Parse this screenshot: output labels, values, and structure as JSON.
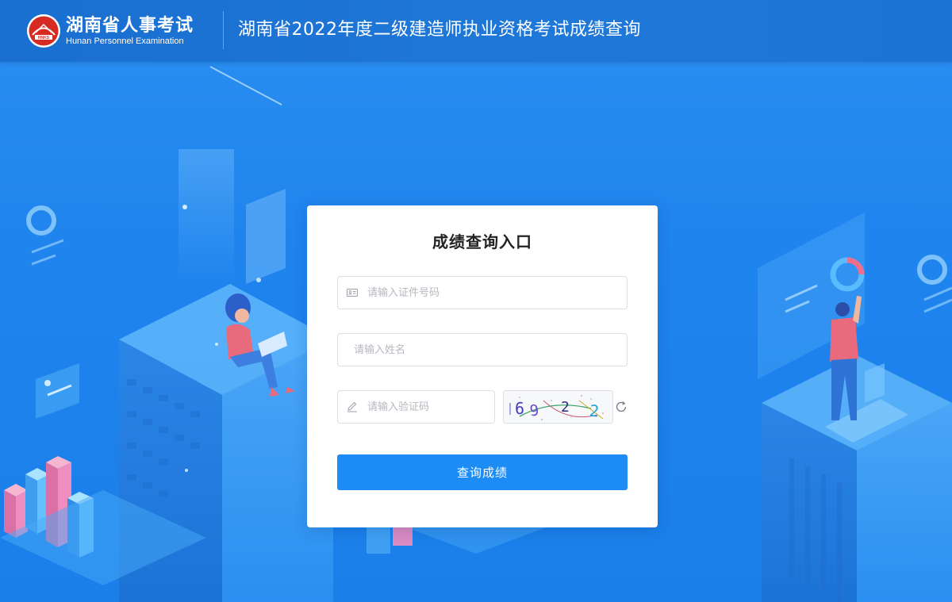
{
  "header": {
    "logo_cn": "湖南省人事考试",
    "logo_en": "Hunan Personnel Examination",
    "logo_badge": "HNKS",
    "title": "湖南省2022年度二级建造师执业资格考试成绩查询"
  },
  "form": {
    "title": "成绩查询入口",
    "id_placeholder": "请输入证件号码",
    "name_placeholder": "请输入姓名",
    "code_placeholder": "请输入验证码",
    "captcha_text": "6922",
    "submit_label": "查询成绩"
  },
  "icons": {
    "id_field": "id-card-icon",
    "code_field": "pencil-icon",
    "refresh": "refresh-icon"
  },
  "colors": {
    "header_bg": "#1a6fd0",
    "page_bg": "#2a8ff0",
    "button": "#1d8cf5",
    "logo_red": "#d62a22"
  }
}
